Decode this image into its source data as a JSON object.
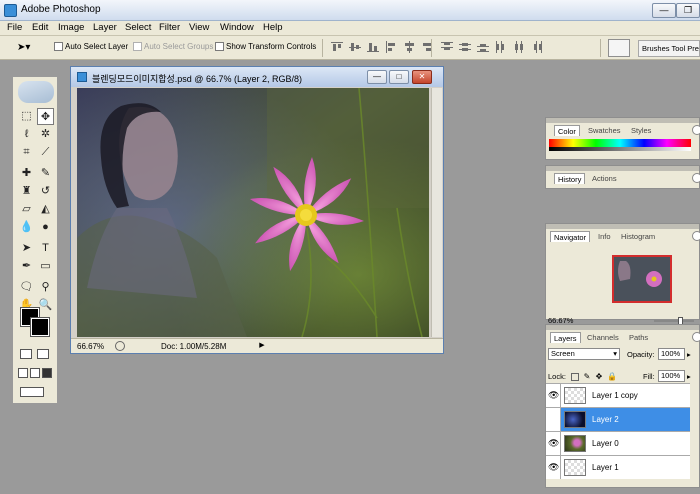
{
  "app": {
    "title": "Adobe Photoshop",
    "min_label": "—",
    "max_label": "❐"
  },
  "menu": [
    "File",
    "Edit",
    "Image",
    "Layer",
    "Select",
    "Filter",
    "View",
    "Window",
    "Help"
  ],
  "options": {
    "tool_glyph": "➤▾",
    "auto_select_layer": "Auto Select Layer",
    "auto_select_groups": "Auto Select Groups",
    "show_transform_controls": "Show Transform Controls",
    "tool_presets_tab": "Brushes  Tool Presets"
  },
  "document": {
    "title": "블렌딩모드이미지합성.psd @ 66.7% (Layer 2, RGB/8)",
    "min_label": "—",
    "max_label": "□",
    "close_label": "✕",
    "zoom": "66.67%",
    "doc_size": "Doc: 1.00M/5.28M",
    "nav_arrow": "▶"
  },
  "colors": {
    "foreground": "#000000",
    "background": "#000000",
    "selection": "#3e8ee6"
  },
  "panels": {
    "color": {
      "tabs": [
        "Color",
        "Swatches",
        "Styles"
      ]
    },
    "history": {
      "tabs": [
        "History",
        "Actions"
      ]
    },
    "navigator": {
      "tabs": [
        "Navigator",
        "Info",
        "Histogram"
      ],
      "zoom": "66.67%"
    },
    "layers": {
      "tabs": [
        "Layers",
        "Channels",
        "Paths"
      ],
      "blend_mode": "Screen",
      "opacity_label": "Opacity:",
      "opacity": "100%",
      "lock_label": "Lock:",
      "fill_label": "Fill:",
      "fill": "100%",
      "items": [
        {
          "name": "Layer 1 copy",
          "visible_icon": "👁",
          "thumb": "checker"
        },
        {
          "name": "Layer 2",
          "visible_icon": "👁",
          "thumb": "dark-blue"
        },
        {
          "name": "Layer 0",
          "visible_icon": "👁",
          "thumb": "flower"
        },
        {
          "name": "Layer 1",
          "visible_icon": "👁",
          "thumb": "checker"
        }
      ]
    }
  },
  "tool_icons": [
    "marquee-icon",
    "move-icon",
    "lasso-icon",
    "magic-wand-icon",
    "crop-icon",
    "slice-icon",
    "healing-brush-icon",
    "brush-icon",
    "clone-stamp-icon",
    "history-brush-icon",
    "eraser-icon",
    "paint-bucket-icon",
    "blur-icon",
    "dodge-icon",
    "path-selection-icon",
    "type-icon",
    "pen-icon",
    "shape-icon",
    "notes-icon",
    "eyedropper-icon",
    "hand-icon",
    "zoom-icon"
  ]
}
